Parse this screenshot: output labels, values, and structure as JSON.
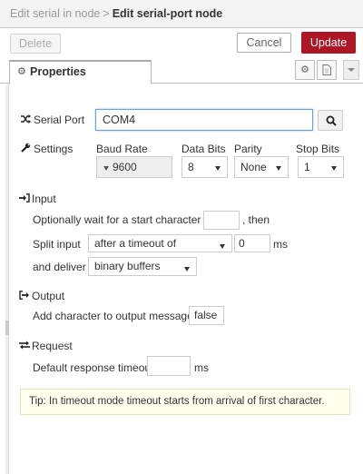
{
  "header": {
    "parent": "Edit serial in node",
    "separator": ">",
    "current": "Edit serial-port node"
  },
  "toolbar": {
    "delete_label": "Delete",
    "cancel_label": "Cancel",
    "update_label": "Update",
    "update_color": "#ad1625"
  },
  "tab": {
    "label": "Properties",
    "icon": "gear-icon"
  },
  "serial_port": {
    "label": "Serial Port",
    "value": "COM4",
    "icon": "shuffle-icon"
  },
  "settings": {
    "label": "Settings",
    "icon": "wrench-icon",
    "baud_rate": {
      "label": "Baud Rate",
      "value": "9600"
    },
    "data_bits": {
      "label": "Data Bits",
      "value": "8"
    },
    "parity": {
      "label": "Parity",
      "value": "None"
    },
    "stop_bits": {
      "label": "Stop Bits",
      "value": "1"
    }
  },
  "input": {
    "heading": "Input",
    "icon": "sign-in-icon",
    "start_char_prefix": "Optionally wait for a start character of",
    "start_char_value": "",
    "start_char_suffix": ", then",
    "split_label": "Split input",
    "split_value": "after a timeout of",
    "timeout_value": "0",
    "timeout_unit": "ms",
    "deliver_label": "and deliver",
    "deliver_value": "binary buffers"
  },
  "output": {
    "heading": "Output",
    "icon": "sign-out-icon",
    "add_char_label": "Add character to output messages",
    "add_char_value": "false"
  },
  "request": {
    "heading": "Request",
    "icon": "exchange-icon",
    "timeout_label": "Default response timeout",
    "timeout_value": "",
    "timeout_unit": "ms"
  },
  "tip": "Tip: In timeout mode timeout starts from arrival of first character."
}
